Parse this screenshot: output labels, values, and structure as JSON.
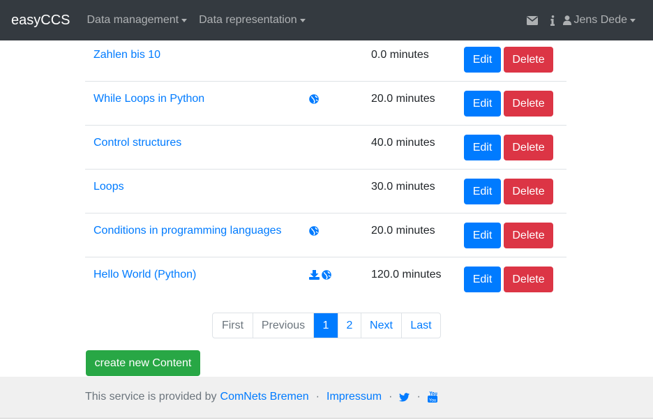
{
  "navbar": {
    "brand": "easyCCS",
    "menus": [
      {
        "label": "Data management"
      },
      {
        "label": "Data representation"
      }
    ],
    "user": "Jens Dede",
    "icons": [
      "envelope-icon",
      "info-icon",
      "user-icon"
    ]
  },
  "contents": [
    {
      "title": "Zahlen bis 10",
      "icons": [],
      "duration": "0.0 minutes",
      "edit": "Edit",
      "delete": "Delete"
    },
    {
      "title": "While Loops in Python",
      "icons": [
        "globe-icon"
      ],
      "duration": "20.0 minutes",
      "edit": "Edit",
      "delete": "Delete"
    },
    {
      "title": "Control structures",
      "icons": [],
      "duration": "40.0 minutes",
      "edit": "Edit",
      "delete": "Delete"
    },
    {
      "title": "Loops",
      "icons": [],
      "duration": "30.0 minutes",
      "edit": "Edit",
      "delete": "Delete"
    },
    {
      "title": "Conditions in programming languages",
      "icons": [
        "globe-icon"
      ],
      "duration": "20.0 minutes",
      "edit": "Edit",
      "delete": "Delete"
    },
    {
      "title": "Hello World (Python)",
      "icons": [
        "download-icon",
        "globe-icon"
      ],
      "duration": "120.0 minutes",
      "edit": "Edit",
      "delete": "Delete"
    }
  ],
  "pagination": {
    "first": "First",
    "previous": "Previous",
    "pages": [
      "1",
      "2"
    ],
    "current": "1",
    "next": "Next",
    "last": "Last"
  },
  "create_button": "create new Content",
  "footer": {
    "text": "This service is provided by",
    "provider": "ComNets Bremen",
    "separator": "·",
    "impressum": "Impressum",
    "icons": [
      "twitter-icon",
      "youtube-icon"
    ]
  },
  "colors": {
    "navbar": "#343a40",
    "primary": "#007bff",
    "danger": "#dc3545",
    "success": "#28a745"
  }
}
